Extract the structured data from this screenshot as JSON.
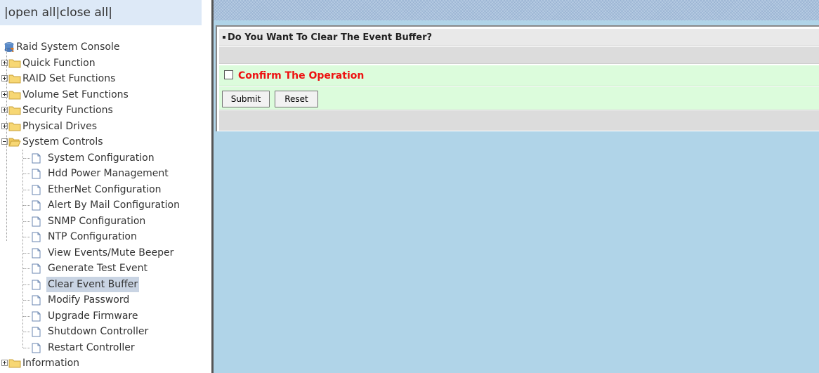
{
  "header": {
    "open_all": "open all",
    "close_all": "close all",
    "sep": "|"
  },
  "tree": {
    "root_label": "Raid System Console",
    "groups": [
      {
        "label": "Quick Function",
        "expanded": false
      },
      {
        "label": "RAID Set Functions",
        "expanded": false
      },
      {
        "label": "Volume Set Functions",
        "expanded": false
      },
      {
        "label": "Security Functions",
        "expanded": false
      },
      {
        "label": "Physical Drives",
        "expanded": false
      },
      {
        "label": "System Controls",
        "expanded": true
      },
      {
        "label": "Information",
        "expanded": false
      }
    ],
    "system_controls_items": [
      "System Configuration",
      "Hdd Power Management",
      "EtherNet Configuration",
      "Alert By Mail Configuration",
      "SNMP Configuration",
      "NTP Configuration",
      "View Events/Mute Beeper",
      "Generate Test Event",
      "Clear Event Buffer",
      "Modify Password",
      "Upgrade Firmware",
      "Shutdown Controller",
      "Restart Controller"
    ],
    "selected_item": "Clear Event Buffer"
  },
  "main": {
    "title": "Do You Want To Clear The Event Buffer?",
    "confirm_label": "Confirm The Operation",
    "confirm_checked": false,
    "submit_label": "Submit",
    "reset_label": "Reset"
  },
  "colors": {
    "confirm_text": "#ee1111",
    "right_background": "#b0d4e8",
    "confirm_row": "#dcfcdc",
    "selected_highlight": "#c9d4e3",
    "header_bar": "#dde9f7"
  }
}
